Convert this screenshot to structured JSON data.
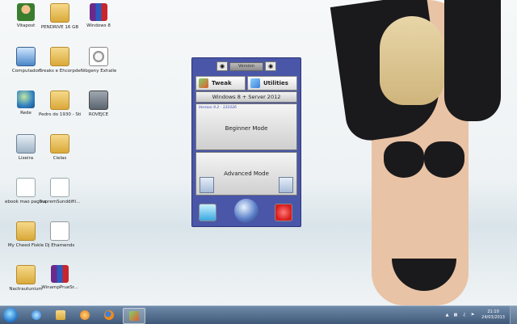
{
  "desktop": {
    "icons": [
      {
        "label": "Vitapost"
      },
      {
        "label": "PENDRIVE 16 GB"
      },
      {
        "label": "Windows 8"
      },
      {
        "label": "Computador"
      },
      {
        "label": "Breaks e Ehcorpde"
      },
      {
        "label": "Nibgeny Exhalle"
      },
      {
        "label": "Rede"
      },
      {
        "label": "Pedro do 1930 - Stinds of the 11..."
      },
      {
        "label": "ROVEJCE"
      },
      {
        "label": "Lixeira"
      },
      {
        "label": "Cielas"
      },
      {
        "label": "ebook mao pagina 1 e 2"
      },
      {
        "label": "SupremSunddifil..."
      },
      {
        "label": "My Cheed Fiskle"
      },
      {
        "label": "Dj Ehamends"
      },
      {
        "label": "Nactrautunium"
      },
      {
        "label": "WinampPrueSr..."
      }
    ]
  },
  "tool_window": {
    "title": "Version",
    "tab_tweak": "Tweak",
    "tab_utilities": "Utilities",
    "os_label": "Windows 8 + Server 2012",
    "version_text": "Version 9.2 - 121026",
    "beginner_mode": "Beginner Mode",
    "advanced_mode": "Advanced Mode"
  },
  "taskbar": {
    "clock_time": "21:10",
    "clock_date": "24/03/2013"
  },
  "colors": {
    "window_bg": "#4a56a8",
    "taskbar": "#3f5878"
  }
}
